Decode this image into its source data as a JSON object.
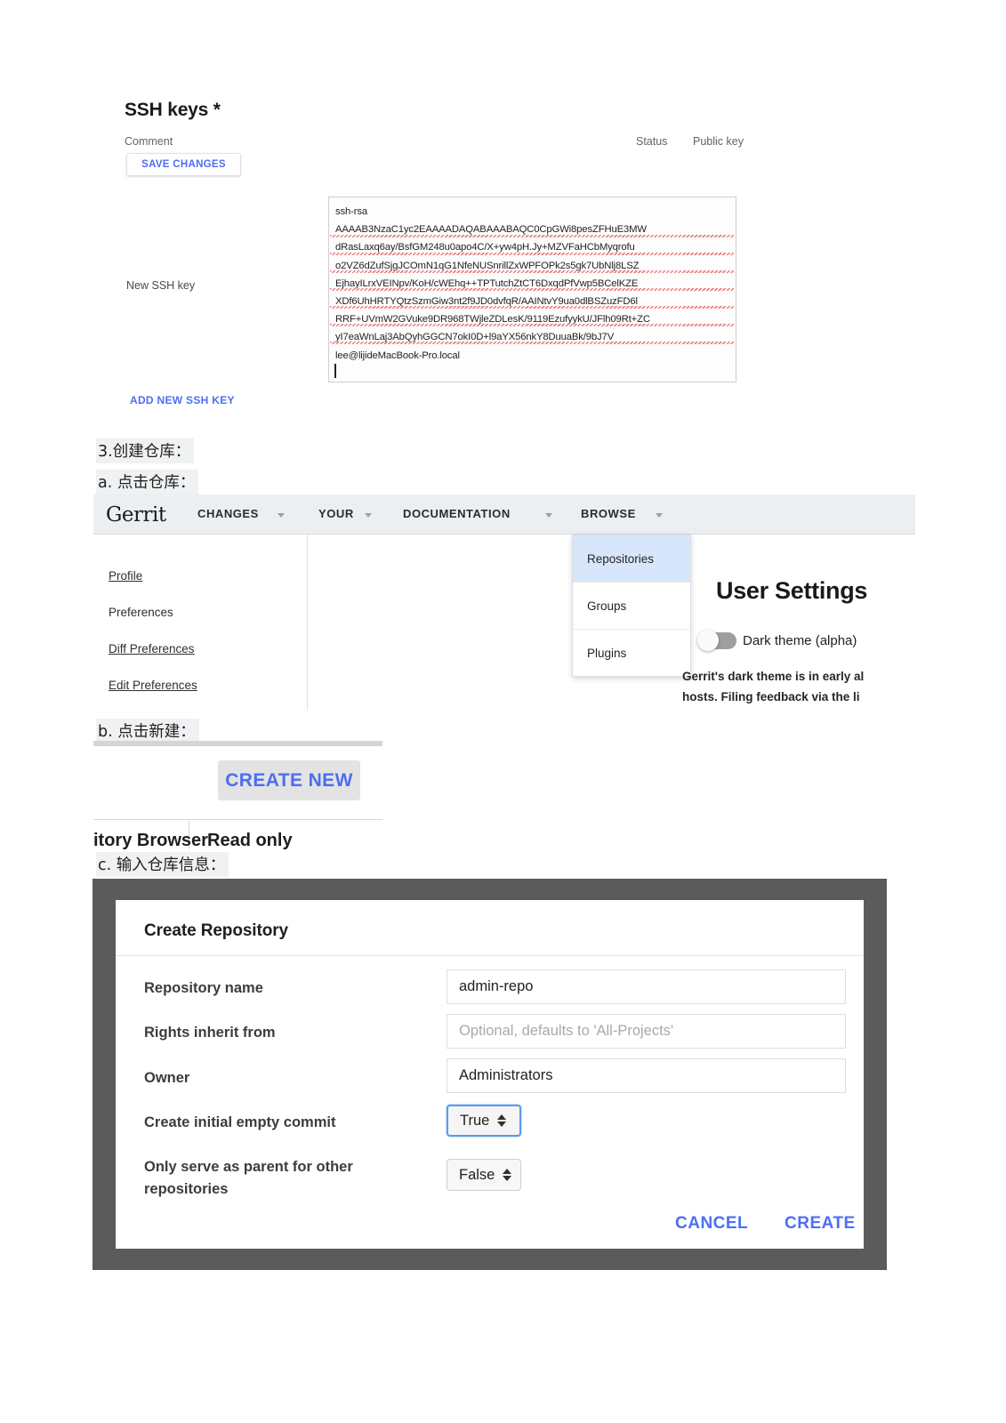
{
  "ssh_section": {
    "title": "SSH keys *",
    "columns": {
      "comment": "Comment",
      "status": "Status",
      "public_key": "Public key"
    },
    "save_changes_label": "SAVE CHANGES",
    "new_ssh_key_label": "New SSH key",
    "add_new_ssh_key_label": "ADD NEW SSH KEY",
    "key_text": "ssh-rsa\nAAAAB3NzaC1yc2EAAAADAQABAAABAQC0CpGWi8pesZFHuE3MW\ndRasLaxq6ay/BsfGM248u0apo4C/X+yw4pH.Jy+MZVFaHCbMyqrofu\no2VZ6dZufSjgJCOmN1qG1NfeNUSnrillZxWPFOPk2s5gk7UbNlj8LSZ\nEjhayILrxVEINpv/KoH/cWEhq++TPTutchZtCT6DxqdPfVwp5BCelKZE\nXDf6UhHRTYQtzSzmGiw3nt2f9JD0dvfqR/AAINtvY9ua0dlBSZuzFD6l\nRRF+UVmW2GVuke9DR968TWjleZDLesK/9119EzufyykU/JFlh09Rt+ZC\nyI7eaWnLaj3AbQyhGGCN7okI0D+l9aYX56nkY8DuuaBk/9bJ7V\nlee@lijideMacBook-Pro.local"
  },
  "annotations": {
    "step3": "3.创建仓库：",
    "step3a": "a. 点击仓库：",
    "step3b": "b. 点击新建：",
    "step3c": "c. 输入仓库信息："
  },
  "gerrit": {
    "logo": "Gerrit",
    "nav": [
      {
        "label": "CHANGES",
        "has_caret": true
      },
      {
        "label": "YOUR",
        "has_caret": true
      },
      {
        "label": "DOCUMENTATION",
        "has_caret": true
      },
      {
        "label": "BROWSE",
        "has_caret": true
      }
    ],
    "sidebar": [
      {
        "label": "Profile",
        "underlined": true
      },
      {
        "label": "Preferences",
        "underlined": false
      },
      {
        "label": "Diff Preferences",
        "underlined": true
      },
      {
        "label": "Edit Preferences",
        "underlined": true
      }
    ],
    "browse_dropdown": [
      {
        "label": "Repositories",
        "selected": true
      },
      {
        "label": "Groups",
        "selected": false
      },
      {
        "label": "Plugins",
        "selected": false
      }
    ],
    "user_settings_title": "User Settings",
    "dark_theme_label": "Dark theme (alpha)",
    "dark_theme_desc_line1": "Gerrit's dark theme is in early al",
    "dark_theme_desc_line2": "hosts. Filing feedback via the li",
    "dark_theme_enabled": false
  },
  "create_new_shot": {
    "button_label": "CREATE NEW",
    "table_header_col1": "itory Browser",
    "table_header_col2": "Read only"
  },
  "create_repository_dialog": {
    "title": "Create Repository",
    "rows": [
      {
        "label": "Repository name",
        "value": "admin-repo",
        "is_placeholder": false,
        "type": "text"
      },
      {
        "label": "Rights inherit from",
        "value": "Optional, defaults to 'All-Projects'",
        "is_placeholder": true,
        "type": "text"
      },
      {
        "label": "Owner",
        "value": "Administrators",
        "is_placeholder": false,
        "type": "text"
      },
      {
        "label": "Create initial empty commit",
        "value": "True",
        "is_placeholder": false,
        "type": "select"
      },
      {
        "label": "Only serve as parent for other repositories",
        "value": "False",
        "is_placeholder": false,
        "type": "select"
      }
    ],
    "cancel_label": "CANCEL",
    "create_label": "CREATE"
  },
  "colors": {
    "link_blue": "#4c6ef5",
    "dropdown_selected": "#d8e6fb",
    "nav_bar_bg": "#eceff1",
    "dialog_frame": "#5b5b5b",
    "annotation_bg": "#eff1f3",
    "focus_border": "#5e9bea"
  }
}
